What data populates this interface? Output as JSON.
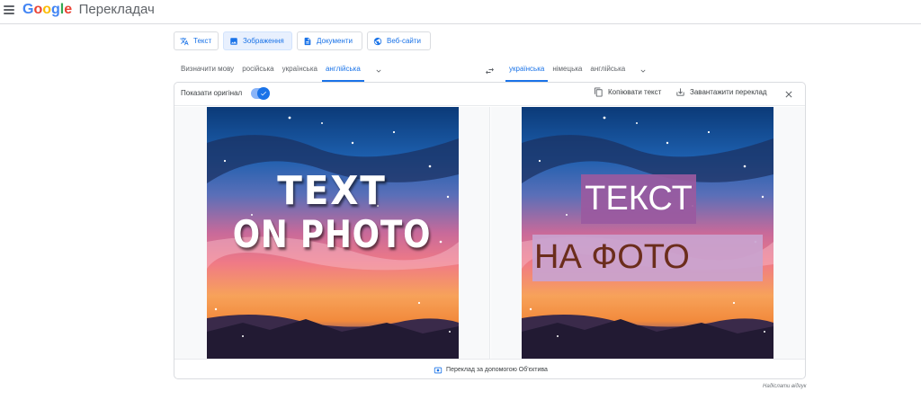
{
  "header": {
    "logo_google": "Google",
    "logo_product": "Перекладач",
    "colors": {
      "blue": "#4285f4",
      "red": "#ea4335",
      "yellow": "#fbbc05",
      "green": "#34a853"
    }
  },
  "modes": [
    {
      "label": "Текст",
      "icon": "translate-icon",
      "active": false
    },
    {
      "label": "Зображення",
      "icon": "image-icon",
      "active": true
    },
    {
      "label": "Документи",
      "icon": "document-icon",
      "active": false
    },
    {
      "label": "Веб-сайти",
      "icon": "globe-icon",
      "active": false
    }
  ],
  "source_languages": [
    {
      "label": "Визначити мову",
      "selected": false
    },
    {
      "label": "російська",
      "selected": false
    },
    {
      "label": "українська",
      "selected": false
    },
    {
      "label": "англійська",
      "selected": true
    }
  ],
  "target_languages": [
    {
      "label": "українська",
      "selected": true
    },
    {
      "label": "німецька",
      "selected": false
    },
    {
      "label": "англійська",
      "selected": false
    }
  ],
  "toolbar": {
    "show_original_label": "Показати оригінал",
    "show_original_on": true,
    "copy_label": "Копіювати текст",
    "download_label": "Завантажити переклад"
  },
  "images": {
    "original_line1": "TEXT",
    "original_line2": "ON PHOTO",
    "translated_line1": "ТЕКСТ",
    "translated_line2": "НА ФОТО"
  },
  "footer": {
    "lens_label": "Переклад за допомогою Об'єктива",
    "feedback_label": "Надіслати відгук"
  },
  "accent_color": "#1a73e8"
}
